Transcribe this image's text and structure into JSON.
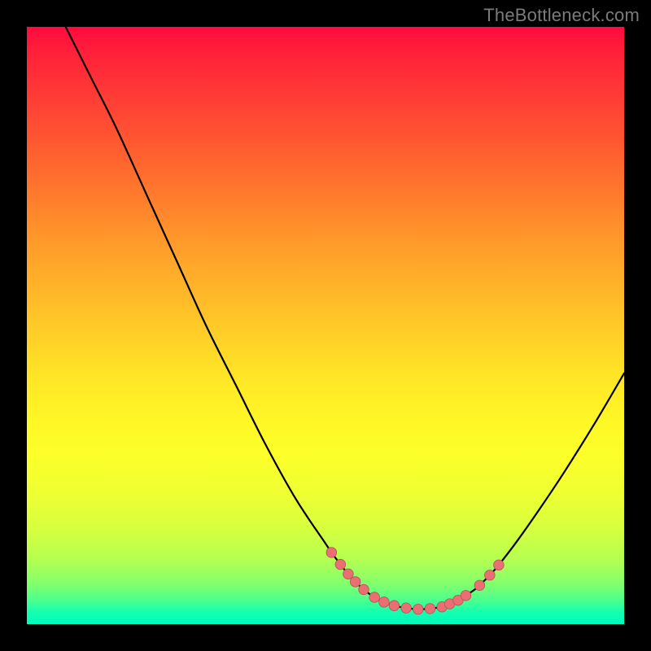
{
  "watermark": "TheBottleneck.com",
  "colors": {
    "curve_stroke": "#000000",
    "marker_fill": "#e96f74",
    "marker_stroke": "#b94f53"
  },
  "chart_data": {
    "type": "line",
    "title": "",
    "xlabel": "",
    "ylabel": "",
    "xlim": [
      0,
      100
    ],
    "ylim": [
      0,
      100
    ],
    "curve": [
      {
        "x": 6.5,
        "y": 100
      },
      {
        "x": 8,
        "y": 97
      },
      {
        "x": 11,
        "y": 91
      },
      {
        "x": 15,
        "y": 83
      },
      {
        "x": 20,
        "y": 72
      },
      {
        "x": 25,
        "y": 61
      },
      {
        "x": 30,
        "y": 50
      },
      {
        "x": 35,
        "y": 40
      },
      {
        "x": 40,
        "y": 30
      },
      {
        "x": 45,
        "y": 21
      },
      {
        "x": 50,
        "y": 13.5
      },
      {
        "x": 51,
        "y": 12
      },
      {
        "x": 52.5,
        "y": 10
      },
      {
        "x": 54,
        "y": 8.1
      },
      {
        "x": 55,
        "y": 7.1
      },
      {
        "x": 56.5,
        "y": 5.7
      },
      {
        "x": 58.2,
        "y": 4.5
      },
      {
        "x": 59.8,
        "y": 3.7
      },
      {
        "x": 61.5,
        "y": 3.1
      },
      {
        "x": 63.5,
        "y": 2.7
      },
      {
        "x": 65.5,
        "y": 2.5
      },
      {
        "x": 67.5,
        "y": 2.6
      },
      {
        "x": 69.5,
        "y": 2.9
      },
      {
        "x": 70.8,
        "y": 3.4
      },
      {
        "x": 72.2,
        "y": 4.0
      },
      {
        "x": 73.5,
        "y": 4.8
      },
      {
        "x": 75,
        "y": 5.8
      },
      {
        "x": 76,
        "y": 6.7
      },
      {
        "x": 77.5,
        "y": 8.2
      },
      {
        "x": 79,
        "y": 9.9
      },
      {
        "x": 82,
        "y": 13.8
      },
      {
        "x": 86,
        "y": 19.5
      },
      {
        "x": 90,
        "y": 25.5
      },
      {
        "x": 95,
        "y": 33.5
      },
      {
        "x": 100,
        "y": 42
      }
    ],
    "markers": [
      {
        "x": 51.0,
        "y": 12.0
      },
      {
        "x": 52.5,
        "y": 10.0
      },
      {
        "x": 53.8,
        "y": 8.4
      },
      {
        "x": 55.0,
        "y": 7.1
      },
      {
        "x": 56.4,
        "y": 5.8
      },
      {
        "x": 58.2,
        "y": 4.5
      },
      {
        "x": 59.8,
        "y": 3.7
      },
      {
        "x": 61.5,
        "y": 3.1
      },
      {
        "x": 63.5,
        "y": 2.7
      },
      {
        "x": 65.5,
        "y": 2.5
      },
      {
        "x": 67.5,
        "y": 2.6
      },
      {
        "x": 69.5,
        "y": 2.9
      },
      {
        "x": 70.8,
        "y": 3.4
      },
      {
        "x": 72.2,
        "y": 4.0
      },
      {
        "x": 73.5,
        "y": 4.8
      },
      {
        "x": 75.8,
        "y": 6.5
      },
      {
        "x": 77.5,
        "y": 8.2
      },
      {
        "x": 79.0,
        "y": 9.9
      }
    ]
  }
}
